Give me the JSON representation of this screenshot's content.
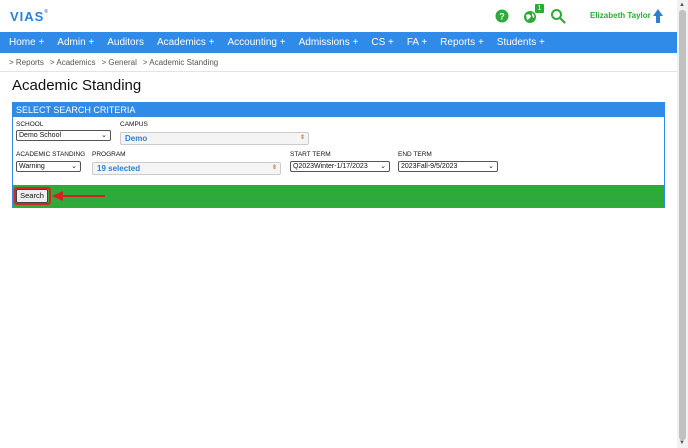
{
  "header": {
    "logo": "VIAS",
    "logo_mark": "®",
    "notification_count": "1",
    "user_name": "Elizabeth Taylor"
  },
  "nav": {
    "items": [
      "Home +",
      "Admin +",
      "Auditors",
      "Academics +",
      "Accounting +",
      "Admissions +",
      "CS +",
      "FA +",
      "Reports +",
      "Students +"
    ]
  },
  "breadcrumb": [
    "> Reports",
    "> Academics",
    "> General",
    "> Academic Standing"
  ],
  "page_title": "Academic Standing",
  "criteria": {
    "heading": "SELECT SEARCH CRITERIA",
    "school_label": "SCHOOL",
    "school_value": "Demo School",
    "campus_label": "CAMPUS",
    "campus_value": "Demo",
    "standing_label": "ACADEMIC STANDING",
    "standing_value": "Warning",
    "program_label": "PROGRAM",
    "program_value": "19 selected",
    "start_term_label": "START TERM",
    "start_term_value": "Q2023Winter-1/17/2023",
    "end_term_label": "END TERM",
    "end_term_value": "2023Fall-9/5/2023",
    "search_label": "Search"
  },
  "colors": {
    "nav_blue": "#2f8ae8",
    "action_green": "#2eaa3a",
    "annotation_red": "#d22222"
  },
  "icons": [
    "help-icon",
    "globe-icon",
    "search-icon",
    "user-arrow-icon",
    "caret-down-icon"
  ]
}
